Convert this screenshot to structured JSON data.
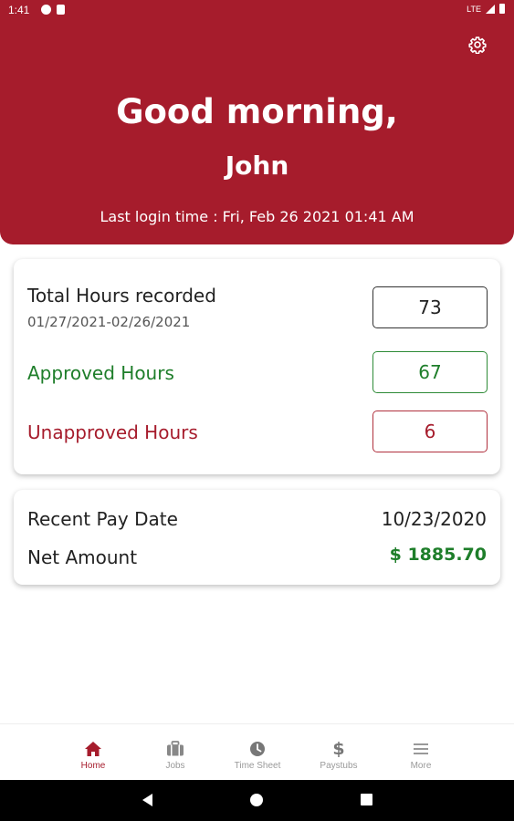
{
  "status_bar": {
    "time": "1:41",
    "network": "LTE"
  },
  "header": {
    "greeting": "Good morning,",
    "user_name": "John",
    "last_login": "Last login time : Fri, Feb 26 2021 01:41 AM"
  },
  "hours_card": {
    "total_label": "Total Hours recorded",
    "date_range": "01/27/2021-02/26/2021",
    "total_value": "73",
    "approved_label": "Approved Hours",
    "approved_value": "67",
    "unapproved_label": "Unapproved Hours",
    "unapproved_value": "6"
  },
  "pay_card": {
    "recent_pay_label": "Recent Pay Date",
    "recent_pay_date": "10/23/2020",
    "net_amount_label": "Net Amount",
    "net_amount_value": "$ 1885.70"
  },
  "bottom_nav": [
    {
      "label": "Home",
      "icon": "home-icon",
      "active": true
    },
    {
      "label": "Jobs",
      "icon": "briefcase-icon",
      "active": false
    },
    {
      "label": "Time Sheet",
      "icon": "clock-icon",
      "active": false
    },
    {
      "label": "Paystubs",
      "icon": "dollar-icon",
      "active": false
    },
    {
      "label": "More",
      "icon": "menu-icon",
      "active": false
    }
  ],
  "colors": {
    "brand": "#a61c2c",
    "approved": "#1e7e2a",
    "inactive_nav": "#999999"
  }
}
